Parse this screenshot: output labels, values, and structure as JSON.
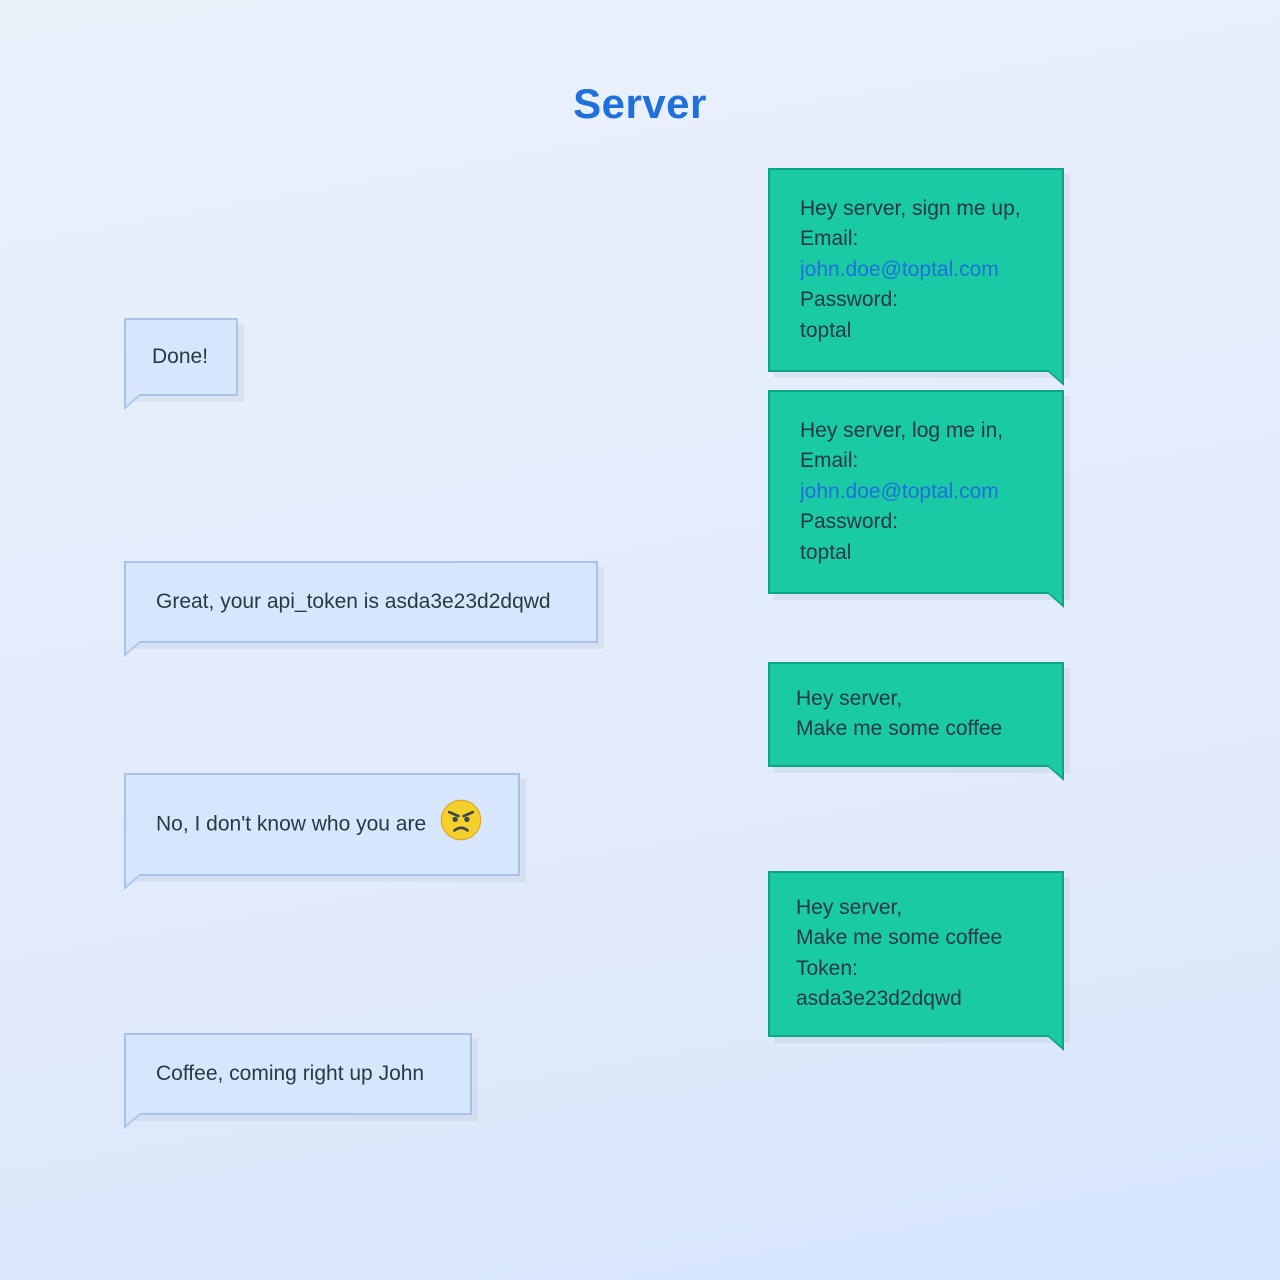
{
  "title": "Server",
  "colors": {
    "title": "#1f6fdd",
    "link": "#1f6fdd",
    "client_bg": "#19caa4",
    "client_border": "#0da486",
    "server_bg": "#d8e6fb",
    "server_border": "#a7c3ec"
  },
  "messages": {
    "client_signup": {
      "line1": "Hey server, sign me up,",
      "email_label": "Email:",
      "email": "john.doe@toptal.com",
      "password_label": "Password:",
      "password": "toptal"
    },
    "server_done": {
      "text": "Done!"
    },
    "client_login": {
      "line1": "Hey server, log me in,",
      "email_label": "Email:",
      "email": "john.doe@toptal.com",
      "password_label": "Password:",
      "password": "toptal"
    },
    "server_token": {
      "text": "Great, your api_token is asda3e23d2dqwd"
    },
    "client_coffee": {
      "line1": "Hey server,",
      "line2": "Make me some coffee"
    },
    "server_deny": {
      "text": "No, I don't know who you are",
      "emoji": "angry-face"
    },
    "client_coffee_token": {
      "line1": "Hey server,",
      "line2": "Make me some coffee",
      "token_label": "Token:",
      "token": "asda3e23d2dqwd"
    },
    "server_coffee": {
      "text": "Coffee, coming right up John"
    }
  }
}
